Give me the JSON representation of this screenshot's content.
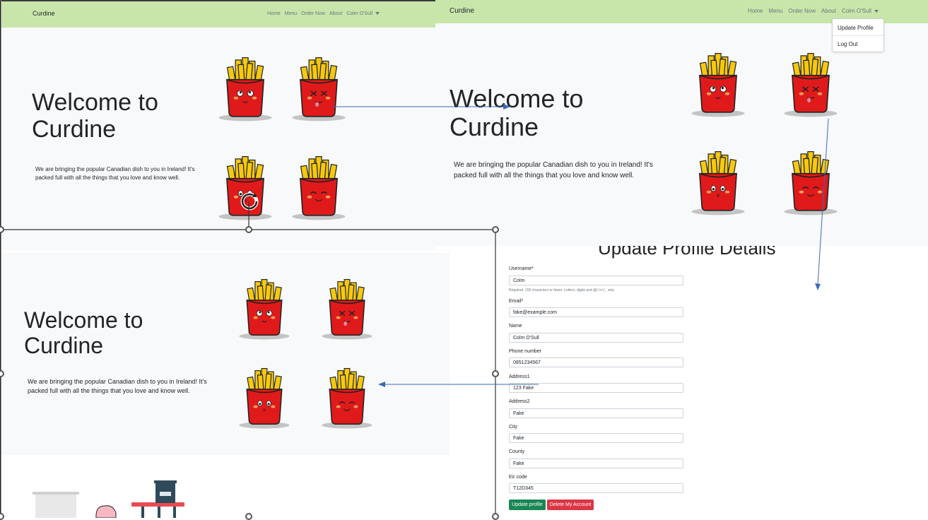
{
  "top_left": {
    "brand": "Curdine",
    "nav": [
      "Home",
      "Menu",
      "Order Now",
      "About",
      "Colm O'Sull"
    ],
    "heading_line1": "Welcome to",
    "heading_line2": "Curdine",
    "tagline_line1": "We are bringing the popular Canadian dish to you in Ireland! It's",
    "tagline_line2": "packed full with all the things that you love and know well."
  },
  "top_right": {
    "brand": "Curdine",
    "nav": [
      "Home",
      "Menu",
      "Order Now",
      "About",
      "Colm O'Sull"
    ],
    "dropdown": [
      "Update Profile",
      "Log Out"
    ],
    "heading_line1": "Welcome to",
    "heading_line2": "Curdine",
    "tagline_line1": "We are bringing the popular Canadian dish to you in Ireland! It's",
    "tagline_line2": "packed full with all the things that you love and know well."
  },
  "bottom_left": {
    "heading_line1": "Welcome to",
    "heading_line2": "Curdine",
    "tagline_line1": "We are bringing the popular Canadian dish to you in Ireland! It's",
    "tagline_line2": "packed full with all the things that you love and know well."
  },
  "form": {
    "title": "Update Profile Details",
    "fields": [
      {
        "label": "Username*",
        "value": "Colm",
        "help": "Required. 150 characters or fewer. Letters, digits and @/./+/-/_ only."
      },
      {
        "label": "Email*",
        "value": "fake@example.com"
      },
      {
        "label": "Name",
        "value": "Colm O'Sull"
      },
      {
        "label": "Phone number",
        "value": "0851234567"
      },
      {
        "label": "Address1",
        "value": "123 Fake"
      },
      {
        "label": "Address2",
        "value": "Fake"
      },
      {
        "label": "City",
        "value": "Fake"
      },
      {
        "label": "County",
        "value": "Fake"
      },
      {
        "label": "Eir code",
        "value": "T12D345"
      }
    ],
    "update_button": "Update profile",
    "delete_button": "Delete My Account"
  },
  "colors": {
    "navbar": "#c8e6aa",
    "hero_bg": "#f8f9fa",
    "fries_box": "#e01a1a",
    "fries": "#f6c90e",
    "arrow": "#3a6ab8",
    "update_btn": "#198754",
    "delete_btn": "#dc3545"
  }
}
